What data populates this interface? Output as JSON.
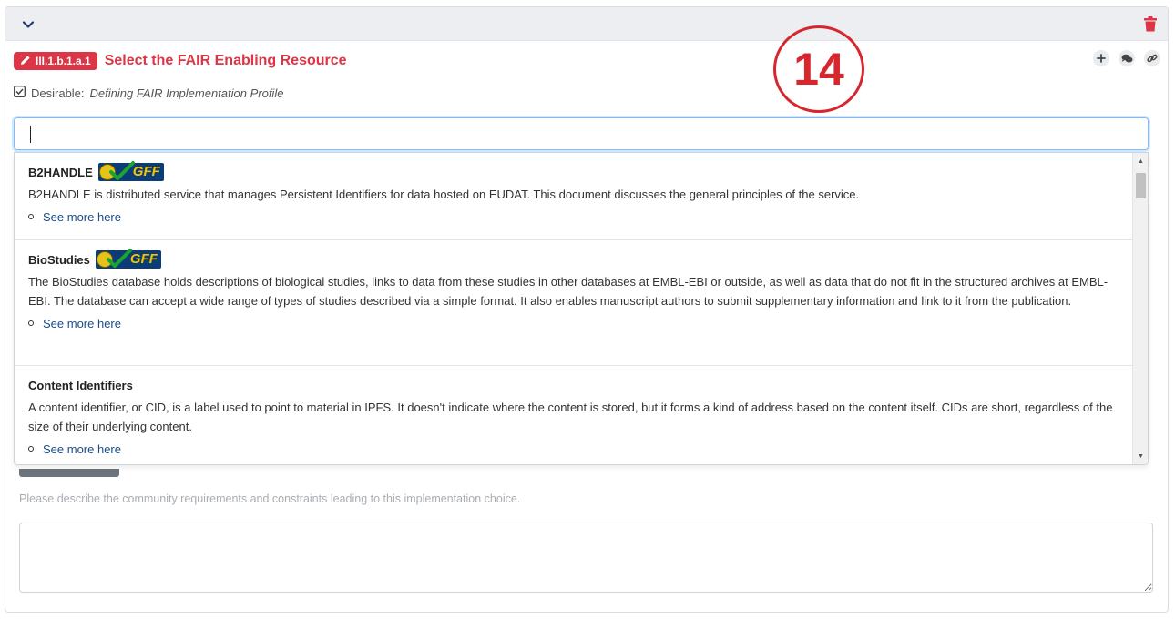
{
  "question": {
    "badge": "III.1.b.1.a.1",
    "title": "Select the FAIR Enabling Resource",
    "desirable_label": "Desirable:",
    "desirable_source": "Defining FAIR Implementation Profile"
  },
  "annotation": "14",
  "search": {
    "value": "",
    "placeholder": ""
  },
  "dropdown": {
    "items": [
      {
        "name": "B2HANDLE",
        "has_gff_badge": true,
        "description": "B2HANDLE is distributed service that manages Persistent Identifiers for data hosted on EUDAT. This document discusses the general principles of the service.",
        "link": "See more here"
      },
      {
        "name": "BioStudies",
        "has_gff_badge": true,
        "description": "The BioStudies database holds descriptions of biological studies, links to data from these studies in other databases at EMBL-EBI or outside, as well as data that do not fit in the structured archives at EMBL-EBI. The database can accept a wide range of types of studies described via a simple format. It also enables manuscript authors to submit supplementary information and link to it from the publication.",
        "link": "See more here"
      },
      {
        "name": "Content Identifiers",
        "has_gff_badge": false,
        "description": "A content identifier, or CID, is a label used to point to material in IPFS. It doesn't indicate where the content is stored, but it forms a kind of address based on the content itself. CIDs are short, regardless of the size of their underlying content.",
        "link": "See more here"
      }
    ]
  },
  "gff_badge_text": "GFF",
  "hint_text": "Please describe the community requirements and constraints leading to this implementation choice.",
  "colors": {
    "accent_red": "#dc3545",
    "link_blue": "#1a4e8a",
    "header_bg": "#eceef1",
    "gff_bg": "#0c3c78",
    "gff_text": "#f2c500"
  },
  "icons": {
    "collapse": "chevron-down-icon",
    "delete": "trash-icon",
    "edit": "pencil-icon",
    "add": "plus-icon",
    "comments": "comments-icon",
    "link": "link-icon",
    "checkbox": "checkbox-checked-icon"
  }
}
